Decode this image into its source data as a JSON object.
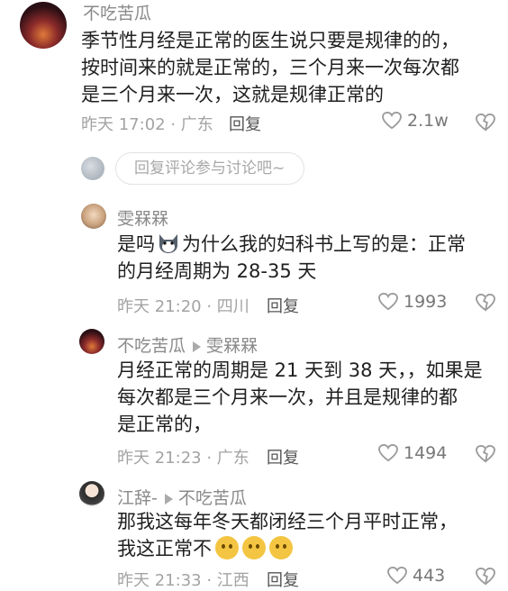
{
  "comments": [
    {
      "user": "不吃苦瓜",
      "text_lines": [
        "季节性月经是正常的医生说只要是规律的的，",
        "按时间来的就是正常的，三个月来一次每次都",
        "是三个月来一次，这就是规律正常的"
      ],
      "meta": "昨天 17:02 · 广东",
      "reply_label": "回复",
      "likes": "2.1w"
    },
    {
      "user": "雯槑槑",
      "text_lines": [
        "是吗",
        "为什么我的妇科书上写的是：正常",
        "的月经周期为 28-35 天"
      ],
      "meta": "昨天 21:20 · 四川",
      "reply_label": "回复",
      "likes": "1993"
    },
    {
      "user": "不吃苦瓜",
      "reply_to": "雯槑槑",
      "text_lines": [
        "月经正常的周期是 21 天到 38 天，，如果是",
        "每次都是三个月来一次，并且是规律的都",
        "是正常的，"
      ],
      "meta": "昨天 21:23 · 广东",
      "reply_label": "回复",
      "likes": "1494"
    },
    {
      "user": "江辞-",
      "reply_to": "不吃苦瓜",
      "text_lines": [
        "那我这每年冬天都闭经三个月平时正常，",
        "我这正常不"
      ],
      "meta": "昨天 21:33 · 江西",
      "reply_label": "回复",
      "likes": "443"
    }
  ],
  "reply_input": {
    "placeholder": "回复评论参与讨论吧~"
  },
  "colors": {
    "like_icon": "#9a9a9a",
    "meta": "#a3a3a3"
  },
  "icons": [
    "heart-icon",
    "broken-heart-icon",
    "cat-emoji-icon",
    "pleading-emoji-icon"
  ]
}
